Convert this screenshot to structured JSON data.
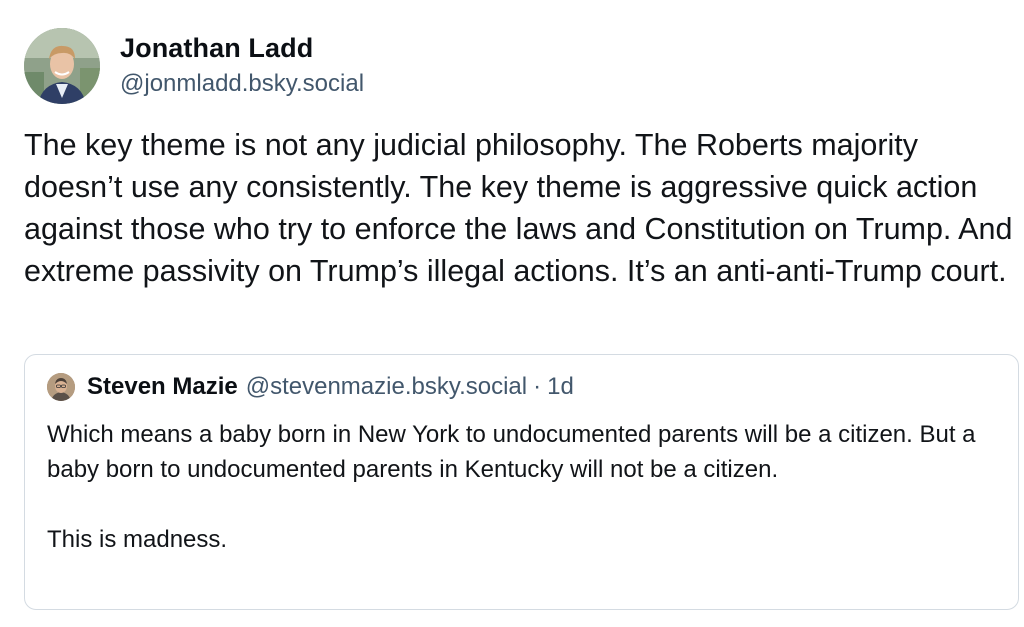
{
  "post": {
    "author": {
      "display_name": "Jonathan Ladd",
      "handle": "@jonmladd.bsky.social",
      "avatar_icon": "profile-photo"
    },
    "text": "The key theme is not any judicial philosophy. The Roberts majority doesn’t use any consistently. The key theme is aggressive quick action against those who try to enforce the laws and Constitution on Trump. And extreme passivity on Trump’s illegal actions. It’s an anti-anti-Trump court."
  },
  "quote": {
    "author": {
      "display_name": "Steven Mazie",
      "handle": "@stevenmazie.bsky.social",
      "separator": "·",
      "time": "1d",
      "avatar_icon": "profile-photo"
    },
    "paragraphs": [
      "Which means a baby born in New York to undocumented parents will be a citizen. But a baby born to undocumented parents in Kentucky will not be a citizen.",
      "This is madness."
    ]
  },
  "colors": {
    "text": "#111418",
    "secondary": "#42576c",
    "border": "#d4dbe2",
    "background": "#ffffff"
  }
}
